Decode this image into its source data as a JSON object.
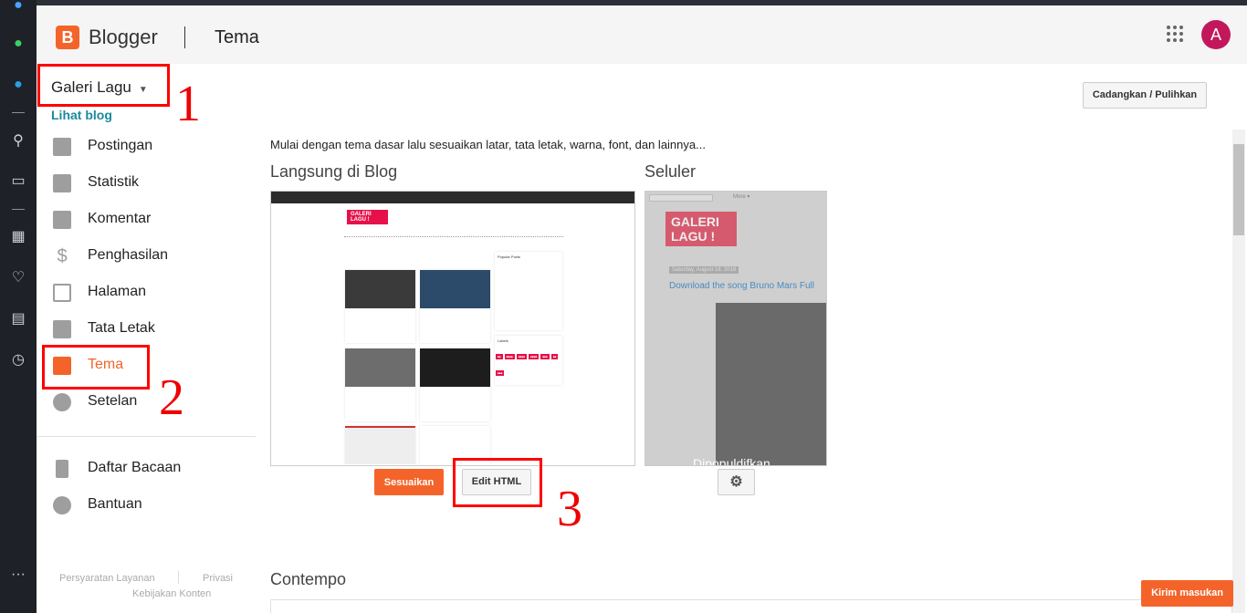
{
  "header": {
    "brand": "Blogger",
    "page_title": "Tema",
    "avatar_letter": "A",
    "logo_letter": "B"
  },
  "sidebar": {
    "blog_name": "Galeri Lagu",
    "view_blog": "Lihat blog",
    "items": [
      {
        "label": "Postingan"
      },
      {
        "label": "Statistik"
      },
      {
        "label": "Komentar"
      },
      {
        "label": "Penghasilan"
      },
      {
        "label": "Halaman"
      },
      {
        "label": "Tata Letak"
      },
      {
        "label": "Tema"
      },
      {
        "label": "Setelan"
      }
    ],
    "secondary": [
      {
        "label": "Daftar Bacaan"
      },
      {
        "label": "Bantuan"
      }
    ],
    "footer": {
      "terms": "Persyaratan Layanan",
      "privacy": "Privasi",
      "content_policy": "Kebijakan Konten"
    }
  },
  "main": {
    "backup_button": "Cadangkan / Pulihkan",
    "intro": "Mulai dengan tema dasar lalu sesuaikan latar, tata letak, warna, font, dan lainnya...",
    "live_title": "Langsung di Blog",
    "mobile_title": "Seluler",
    "customize_button": "Sesuaikan",
    "edit_html_button": "Edit HTML",
    "next_section": "Contempo",
    "preview": {
      "blog_logo": "GALERI LAGU !",
      "popular_posts": "Popular Posts",
      "labels": "Labels",
      "mobile_more": "More ▾",
      "mobile_date": "Saturday, August 18, 2018",
      "mobile_post": "Download the song Bruno Mars Full",
      "mobile_caption": "Dipopuldifkan"
    }
  },
  "annotations": {
    "n1": "1",
    "n2": "2",
    "n3": "3"
  },
  "feedback_button": "Kirim masukan",
  "colors": {
    "accent": "#f4642a",
    "link": "#1a8a9c",
    "annotation": "#ff0000"
  }
}
